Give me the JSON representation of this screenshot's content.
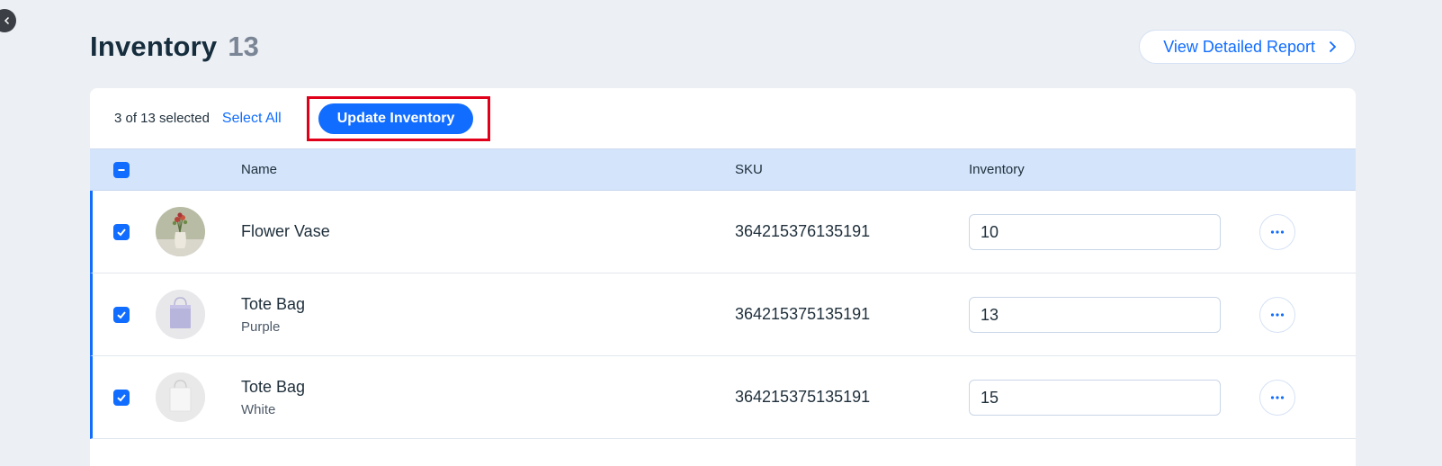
{
  "header": {
    "title": "Inventory",
    "count": "13",
    "report_button": "View Detailed Report"
  },
  "toolbar": {
    "selected_text": "3 of 13 selected",
    "select_all": "Select All",
    "update_button": "Update Inventory"
  },
  "table": {
    "columns": {
      "name": "Name",
      "sku": "SKU",
      "inventory": "Inventory"
    },
    "rows": [
      {
        "name": "Flower Vase",
        "variant": "",
        "sku": "364215376135191",
        "inventory": "10",
        "image": "flower-vase-image"
      },
      {
        "name": "Tote Bag",
        "variant": "Purple",
        "sku": "364215375135191",
        "inventory": "13",
        "image": "purple-tote-image"
      },
      {
        "name": "Tote Bag",
        "variant": "White",
        "sku": "364215375135191",
        "inventory": "15",
        "image": "white-tote-image"
      }
    ]
  },
  "colors": {
    "accent": "#116dff",
    "highlight": "#e0001a",
    "header_bg": "#d4e4fb"
  }
}
